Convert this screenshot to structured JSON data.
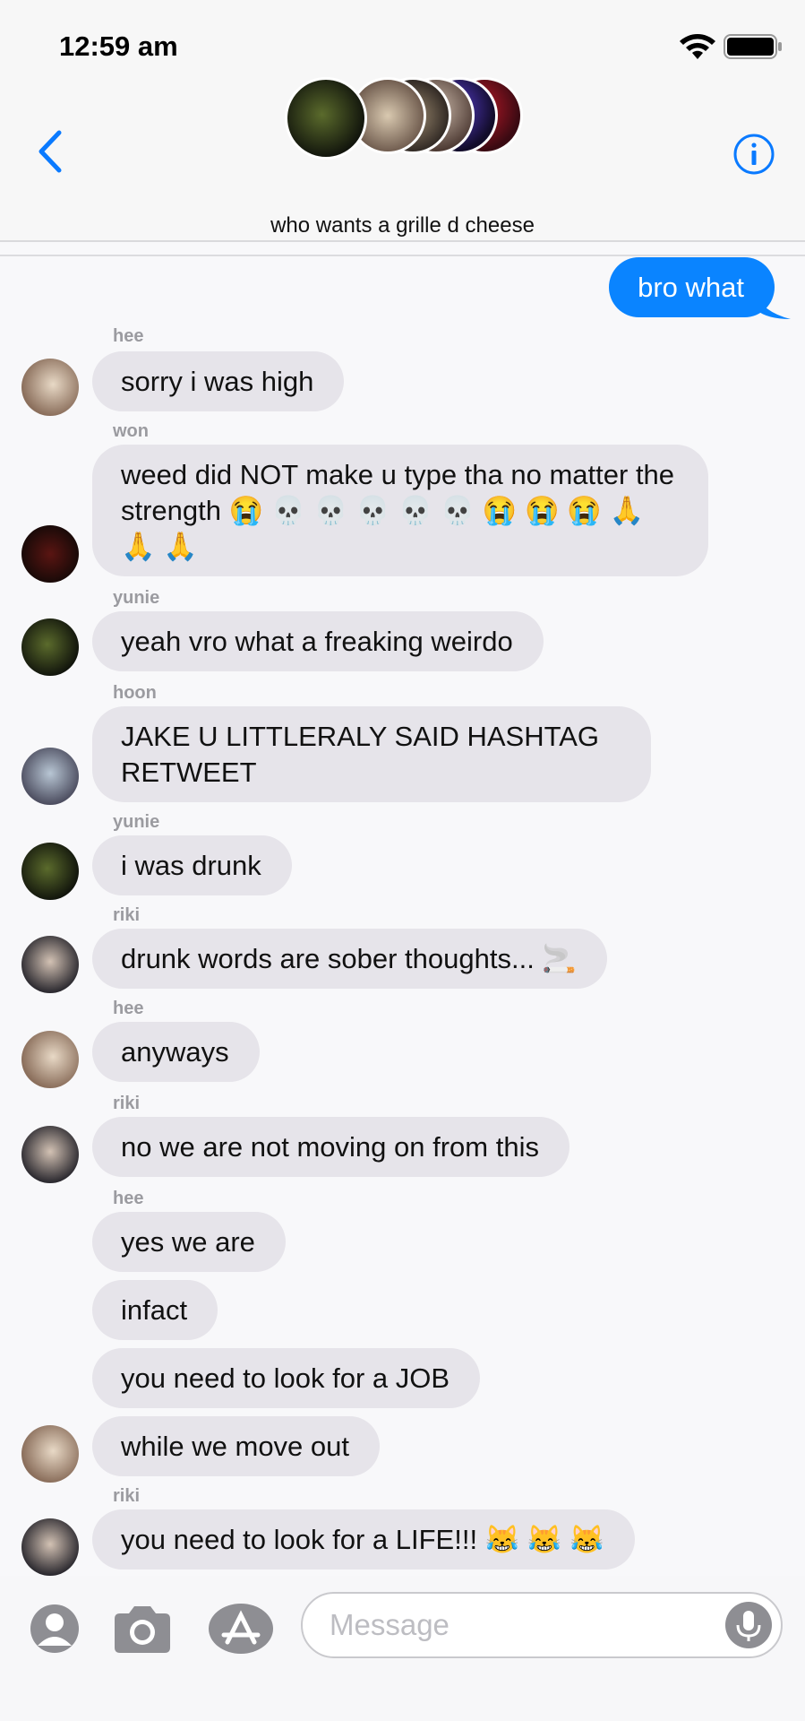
{
  "status_bar": {
    "time": "12:59 am"
  },
  "conversation": {
    "title": "who wants a grille d cheese"
  },
  "messages": [
    {
      "text": "bro what",
      "outgoing": true
    },
    {
      "sender": "hee",
      "text": "sorry i was high"
    },
    {
      "sender": "won",
      "text": "weed did NOT make u type tha no matter the strength 😭 💀 💀 💀 💀 💀 😭 😭 😭 🙏 🙏 🙏"
    },
    {
      "sender": "yunie",
      "text": "yeah vro what a freaking weirdo"
    },
    {
      "sender": "hoon",
      "text": "JAKE U LITTLERALY SAID HASHTAG RETWEET"
    },
    {
      "sender": "yunie",
      "text": "i was drunk"
    },
    {
      "sender": "riki",
      "text": "drunk words are sober thoughts... 🚬"
    },
    {
      "sender": "hee",
      "text": "anyways"
    },
    {
      "sender": "riki",
      "text": "no we are not moving on from this"
    },
    {
      "sender": "hee",
      "text": "yes we are"
    },
    {
      "text": "infact"
    },
    {
      "text": "you need to look for a JOB"
    },
    {
      "text": "while we move out"
    },
    {
      "sender": "riki",
      "text": "you need to look for a LIFE!!! 😹 😹 😹"
    }
  ],
  "composer": {
    "placeholder": "Message"
  },
  "colors": {
    "accent": "#0a84ff",
    "incoming_bubble": "#e6e4ea",
    "sender_name": "#9b9ba0"
  }
}
